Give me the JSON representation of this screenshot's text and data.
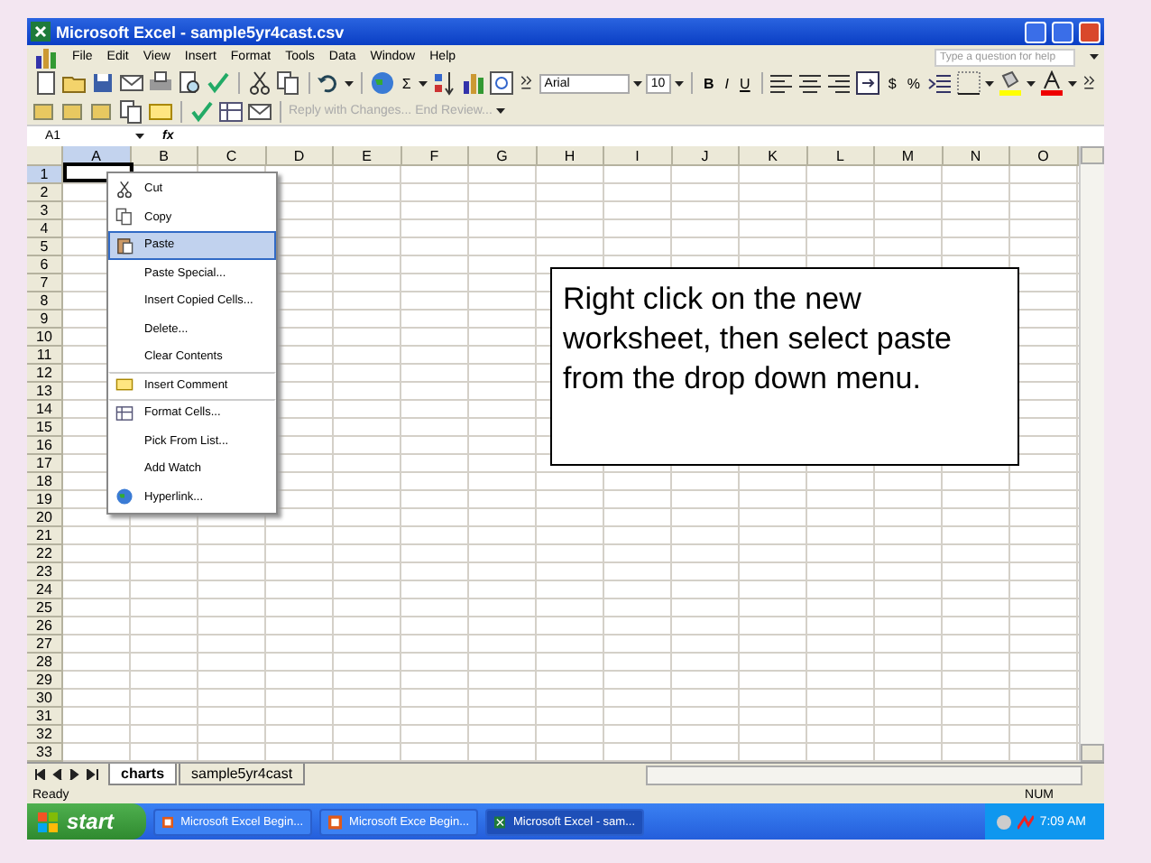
{
  "window": {
    "title": "Microsoft Excel - sample5yr4cast.csv"
  },
  "menu": [
    "File",
    "Edit",
    "View",
    "Insert",
    "Format",
    "Tools",
    "Data",
    "Window",
    "Help"
  ],
  "help_box": {
    "placeholder": "Type a question for help"
  },
  "toolbar": {
    "sum": "Σ",
    "font": "Arial",
    "size": "10",
    "bold": "B",
    "italic": "I",
    "underline": "U",
    "currency": "$",
    "percent": "%"
  },
  "review_toolbar": [
    {
      "label": "Reply with Changes...",
      "disabled": true
    },
    {
      "label": "End Review...",
      "disabled": true
    }
  ],
  "formula_bar": {
    "name_box": "A1",
    "fx": "fx"
  },
  "columns": [
    {
      "label": "A",
      "selected": true
    },
    {
      "label": "B",
      "selected": false
    },
    {
      "label": "C",
      "selected": false
    },
    {
      "label": "D",
      "selected": false
    },
    {
      "label": "E",
      "selected": false
    },
    {
      "label": "F",
      "selected": false
    },
    {
      "label": "G",
      "selected": false
    },
    {
      "label": "H",
      "selected": false
    },
    {
      "label": "I",
      "selected": false
    },
    {
      "label": "J",
      "selected": false
    },
    {
      "label": "K",
      "selected": false
    },
    {
      "label": "L",
      "selected": false
    },
    {
      "label": "M",
      "selected": false
    },
    {
      "label": "N",
      "selected": false
    },
    {
      "label": "O",
      "selected": false
    }
  ],
  "rows": [
    "1",
    "2",
    "3",
    "4",
    "5",
    "6",
    "7",
    "8",
    "9",
    "10",
    "11",
    "12",
    "13",
    "14",
    "15",
    "16",
    "17",
    "18",
    "19",
    "20",
    "21",
    "22",
    "23",
    "24",
    "25",
    "26",
    "27",
    "28",
    "29",
    "30",
    "31",
    "32",
    "33"
  ],
  "context_menu": [
    {
      "label": "Cut",
      "selected": false,
      "separator_before": false
    },
    {
      "label": "Copy",
      "selected": false,
      "separator_before": false
    },
    {
      "label": "Paste",
      "selected": true,
      "separator_before": false
    },
    {
      "label": "Paste Special...",
      "selected": false,
      "separator_before": false
    },
    {
      "label": "Insert Copied Cells...",
      "selected": false,
      "separator_before": false
    },
    {
      "label": "Delete...",
      "selected": false,
      "separator_before": false
    },
    {
      "label": "Clear Contents",
      "selected": false,
      "separator_before": false
    },
    {
      "label": "Insert Comment",
      "selected": false,
      "separator_before": true
    },
    {
      "label": "Format Cells...",
      "selected": false,
      "separator_before": true
    },
    {
      "label": "Pick From List...",
      "selected": false,
      "separator_before": false
    },
    {
      "label": "Add Watch",
      "selected": false,
      "separator_before": false
    },
    {
      "label": "Hyperlink...",
      "selected": false,
      "separator_before": false
    }
  ],
  "callout": "Right click on the new worksheet, then select paste from the drop down menu.",
  "sheet_tabs": [
    {
      "label": "charts",
      "selected": true
    },
    {
      "label": "sample5yr4cast",
      "selected": false
    }
  ],
  "status_bar": {
    "left": "Ready",
    "right": "NUM"
  },
  "taskbar": {
    "start": "start",
    "buttons": [
      {
        "label": "Microsoft Excel Begin...",
        "selected": false,
        "kind": "slides"
      },
      {
        "label": "Microsoft Exce Begin...",
        "selected": false,
        "kind": "slides"
      },
      {
        "label": "Microsoft Excel - sam...",
        "selected": true,
        "kind": "excel"
      }
    ],
    "clock": "7:09 AM"
  }
}
